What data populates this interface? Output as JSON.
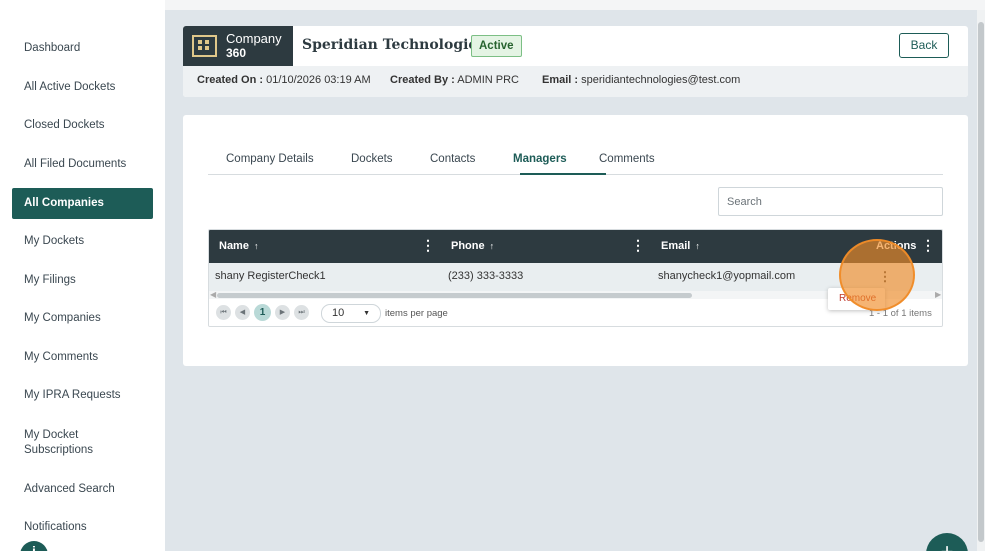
{
  "sidebar": {
    "items": [
      {
        "label": "Dashboard"
      },
      {
        "label": "All Active Dockets"
      },
      {
        "label": "Closed Dockets"
      },
      {
        "label": "All Filed Documents"
      },
      {
        "label": "All Companies",
        "active": true
      },
      {
        "label": "My Dockets"
      },
      {
        "label": "My Filings"
      },
      {
        "label": "My Companies"
      },
      {
        "label": "My Comments"
      },
      {
        "label": "My IPRA Requests"
      },
      {
        "label": "My Docket Subscriptions"
      },
      {
        "label": "Advanced Search"
      },
      {
        "label": "Notifications"
      }
    ]
  },
  "header": {
    "logo_line1": "Company",
    "logo_line2": "360",
    "company_name": "Speridian Technologies",
    "status": "Active",
    "back_label": "Back",
    "created_on_label": "Created On :",
    "created_on_value": "01/10/2026 03:19 AM",
    "created_by_label": "Created By :",
    "created_by_value": "ADMIN PRC",
    "email_label": "Email :",
    "email_value": "speridiantechnologies@test.com"
  },
  "tabs": [
    {
      "label": "Company Details"
    },
    {
      "label": "Dockets"
    },
    {
      "label": "Contacts"
    },
    {
      "label": "Managers",
      "active": true
    },
    {
      "label": "Comments"
    }
  ],
  "search": {
    "placeholder": "Search"
  },
  "grid": {
    "columns": [
      {
        "label": "Name",
        "sort": "↑"
      },
      {
        "label": "Phone",
        "sort": "↑"
      },
      {
        "label": "Email",
        "sort": "↑"
      },
      {
        "label": "Actions"
      }
    ],
    "rows": [
      {
        "name": "shany RegisterCheck1",
        "phone": "(233) 333-3333",
        "email": "shanycheck1@yopmail.com"
      }
    ],
    "row_menu_icon": "kebab-icon",
    "popup_item": "Remove"
  },
  "pager": {
    "current_page": "1",
    "page_size": "10",
    "per_page_label": "items per page",
    "info": "1 - 1 of 1 items"
  },
  "colors": {
    "brand": "#1d5c57",
    "header_dark": "#2d3a40",
    "highlight": "#f08c28"
  }
}
